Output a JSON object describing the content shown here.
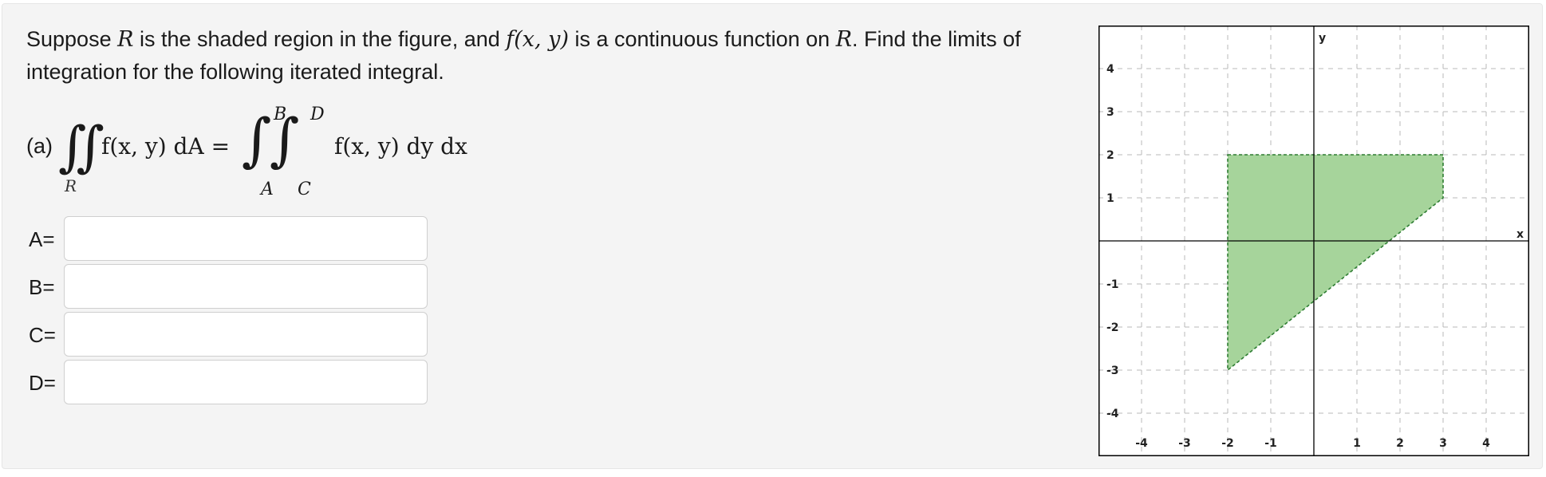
{
  "question": {
    "t1": "Suppose ",
    "R1": "R",
    "t2": " is the shaded region in the figure, and ",
    "f1": "f(x, y)",
    "t3": " is a continuous function on ",
    "R2": "R",
    "t4": ". Find the limits of integration for the following iterated integral."
  },
  "part_a": {
    "label": "(a)",
    "double_integral": "∬",
    "region": "R",
    "lhs": "f(x, y) dA =",
    "integral": "∫",
    "lim_A": "A",
    "lim_B": "B",
    "lim_C": "C",
    "lim_D": "D",
    "rhs": "f(x, y) dy dx"
  },
  "answers": [
    {
      "label": "A=",
      "value": ""
    },
    {
      "label": "B=",
      "value": ""
    },
    {
      "label": "C=",
      "value": ""
    },
    {
      "label": "D=",
      "value": ""
    }
  ],
  "graph": {
    "x_label": "x",
    "y_label": "y",
    "x_ticks": [
      "-4",
      "-3",
      "-2",
      "-1",
      "1",
      "2",
      "3",
      "4"
    ],
    "y_ticks": [
      "4",
      "3",
      "2",
      "1",
      "-1",
      "-2",
      "-3",
      "-4"
    ],
    "region_vertices": [
      [
        -2,
        2
      ],
      [
        3,
        2
      ],
      [
        3,
        1
      ],
      [
        -2,
        -3
      ]
    ],
    "fill_color": "#a6d49b",
    "edge_color": "#2e7d32"
  }
}
